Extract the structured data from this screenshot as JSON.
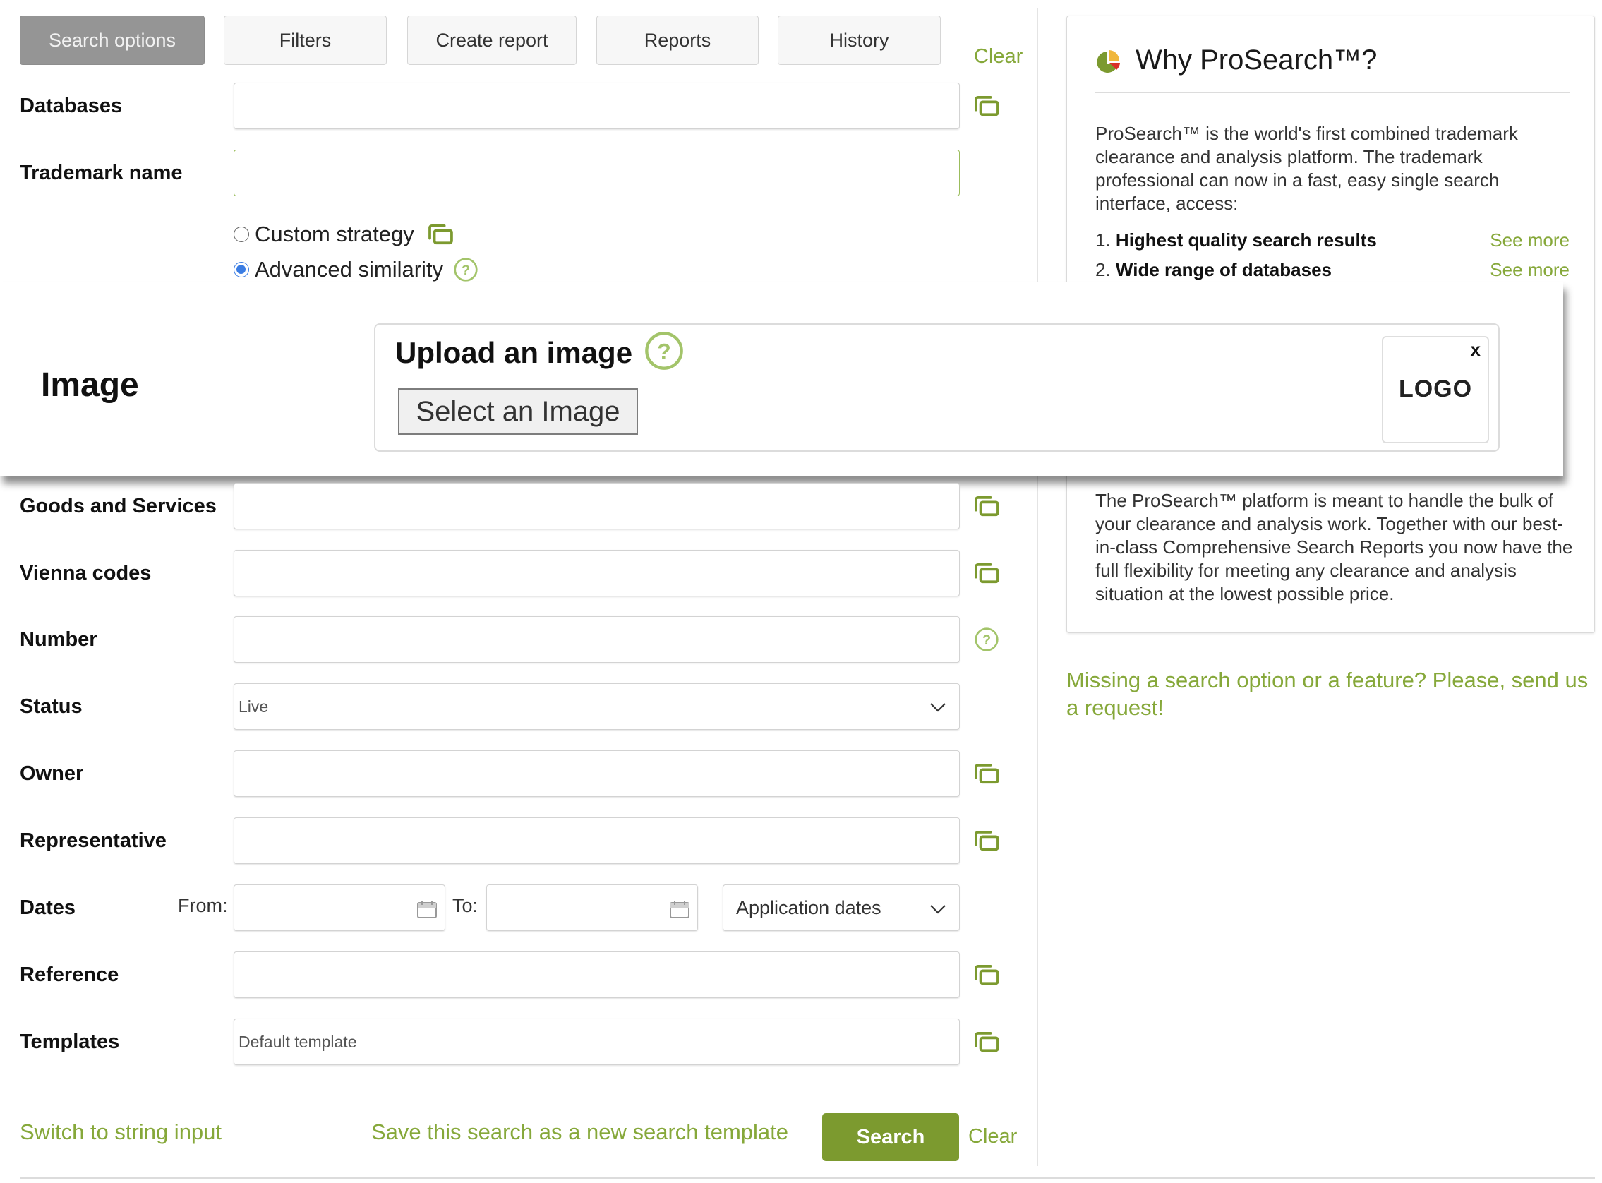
{
  "tabs": [
    {
      "label": "Search options",
      "active": true
    },
    {
      "label": "Filters",
      "active": false
    },
    {
      "label": "Create report",
      "active": false
    },
    {
      "label": "Reports",
      "active": false
    },
    {
      "label": "History",
      "active": false
    }
  ],
  "clear_top_label": "Clear",
  "form": {
    "databases": {
      "label": "Databases",
      "value": ""
    },
    "trademark_name": {
      "label": "Trademark name",
      "value": ""
    },
    "strategy": {
      "options": [
        {
          "label": "Custom strategy",
          "checked": false
        },
        {
          "label": "Advanced similarity",
          "checked": true
        }
      ]
    },
    "image": {
      "label": "Image",
      "upload_title": "Upload an image",
      "select_button": "Select an Image",
      "thumbnail_text": "LOGO",
      "remove_label": "x"
    },
    "goods_services": {
      "label": "Goods and Services",
      "value": ""
    },
    "vienna_codes": {
      "label": "Vienna codes",
      "value": ""
    },
    "number": {
      "label": "Number",
      "value": ""
    },
    "status": {
      "label": "Status",
      "selected": "Live"
    },
    "owner": {
      "label": "Owner",
      "value": ""
    },
    "representative": {
      "label": "Representative",
      "value": ""
    },
    "dates": {
      "label": "Dates",
      "from_label": "From:",
      "from_value": "",
      "to_label": "To:",
      "to_value": "",
      "type_selected": "Application dates"
    },
    "reference": {
      "label": "Reference",
      "value": ""
    },
    "templates": {
      "label": "Templates",
      "value": "Default template"
    }
  },
  "actions": {
    "switch_input": "Switch to string input",
    "save_template": "Save this search as a new search template",
    "search": "Search",
    "clear": "Clear"
  },
  "why_panel": {
    "title": "Why ProSearch™?",
    "intro": "ProSearch™ is the world's first combined trademark clearance and analysis platform. The trademark professional can now in a fast, easy single search interface, access:",
    "items": [
      {
        "number": "1.",
        "text": "Highest quality search results",
        "link": "See more"
      },
      {
        "number": "2.",
        "text": "Wide range of databases",
        "link": "See more"
      }
    ],
    "outro": "The ProSearch™ platform is meant to handle the bulk of your clearance and analysis work. Together with our best-in-class Comprehensive Search Reports you now have the full flexibility for meeting any clearance and analysis situation at the lowest possible price."
  },
  "request_link": "Missing a search option or a feature? Please, send us a request!",
  "colors": {
    "accent_green": "#7c9a2f",
    "link_green": "#86a83a",
    "active_tab": "#959595",
    "radio_blue": "#3b7de3"
  }
}
